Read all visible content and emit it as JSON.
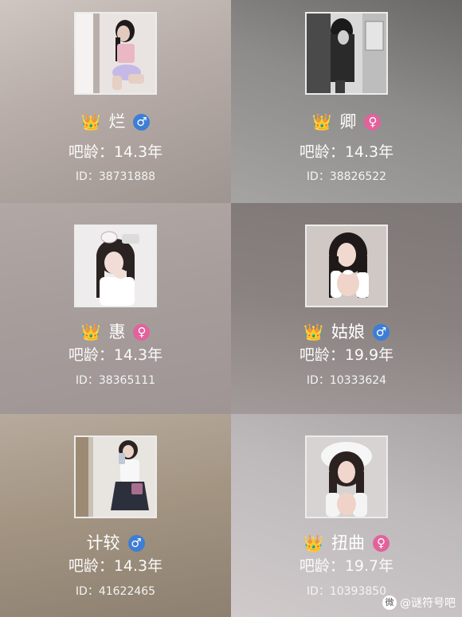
{
  "cards": [
    {
      "name": "烂",
      "gender": "male",
      "gender_symbol": "♂",
      "age": "吧龄：14.3年",
      "id": "ID：38731888"
    },
    {
      "name": "卿",
      "gender": "female",
      "gender_symbol": "♀",
      "age": "吧龄：14.3年",
      "id": "ID：38826522"
    },
    {
      "name": "惠",
      "gender": "female",
      "gender_symbol": "♀",
      "age": "吧龄：14.3年",
      "id": "ID：38365111"
    },
    {
      "name": "姑娘",
      "gender": "male",
      "gender_symbol": "♂",
      "age": "吧龄：19.9年",
      "id": "ID：10333624"
    },
    {
      "name": "计较",
      "gender": "male",
      "gender_symbol": "♂",
      "age": "吧龄：14.3年",
      "id": "ID：41622465"
    },
    {
      "name": "扭曲",
      "gender": "female",
      "gender_symbol": "♀",
      "age": "吧龄：19.7年",
      "id": "ID：10393850"
    }
  ],
  "crown_icon": "👑",
  "watermark": {
    "logo": "微",
    "text": "@谜符号吧"
  }
}
